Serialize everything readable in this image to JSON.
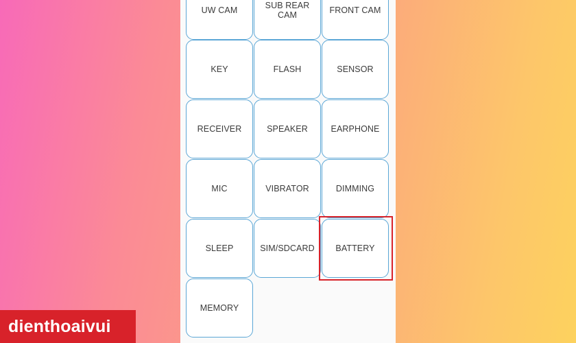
{
  "tiles": [
    {
      "label": "UW CAM"
    },
    {
      "label": "SUB REAR CAM"
    },
    {
      "label": "FRONT CAM"
    },
    {
      "label": "KEY"
    },
    {
      "label": "FLASH"
    },
    {
      "label": "SENSOR"
    },
    {
      "label": "RECEIVER"
    },
    {
      "label": "SPEAKER"
    },
    {
      "label": "EARPHONE"
    },
    {
      "label": "MIC"
    },
    {
      "label": "VIBRATOR"
    },
    {
      "label": "DIMMING"
    },
    {
      "label": "SLEEP"
    },
    {
      "label": "SIM/SDCARD"
    },
    {
      "label": "BATTERY"
    },
    {
      "label": "MEMORY"
    }
  ],
  "highlighted_tile": "BATTERY",
  "brand": {
    "logo_text": "dienthoaivui"
  },
  "colors": {
    "tile_border": "#5aa6d6",
    "highlight": "#d8222a",
    "brand_bg": "#d8222a"
  }
}
